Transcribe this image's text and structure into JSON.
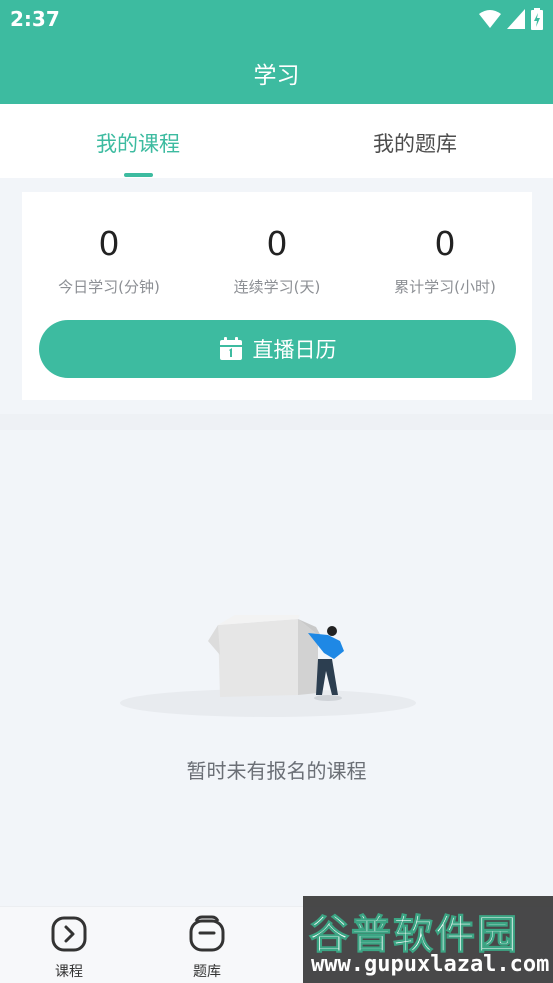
{
  "status_bar": {
    "time": "2:37"
  },
  "app_bar": {
    "title": "学习"
  },
  "tabs": [
    {
      "label": "我的课程",
      "active": true
    },
    {
      "label": "我的题库",
      "active": false
    }
  ],
  "stats": [
    {
      "value": "0",
      "label": "今日学习(分钟)"
    },
    {
      "value": "0",
      "label": "连续学习(天)"
    },
    {
      "value": "0",
      "label": "累计学习(小时)"
    }
  ],
  "live_calendar_button": {
    "label": "直播日历"
  },
  "empty_state": {
    "message": "暂时未有报名的课程"
  },
  "bottom_nav": [
    {
      "label": "课程",
      "icon": "course-icon"
    },
    {
      "label": "题库",
      "icon": "question-bank-icon"
    }
  ],
  "watermark": {
    "title": "谷普软件园",
    "url": "www.gupuxlazal.com"
  },
  "colors": {
    "accent": "#3dbba0",
    "background": "#f2f5f9"
  }
}
